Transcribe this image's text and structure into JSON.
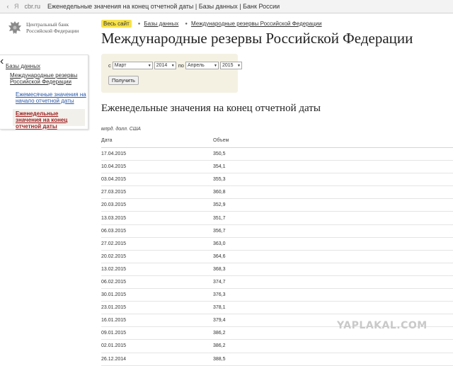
{
  "browser": {
    "back_icon": "arrow-left-icon",
    "brand": "Я",
    "domain": "cbr.ru",
    "page_title": "Еженедельные значения на конец отчетной даты | Базы данных | Банк России"
  },
  "logo": {
    "line1": "Центральный банк",
    "line2": "Российской Федерации"
  },
  "sidebar": {
    "header": "Базы данных",
    "items": [
      {
        "label": "Международные резервы Российской Федерации"
      },
      {
        "label": "Ежемесячные значения на начало отчетной даты"
      },
      {
        "label": "Еженедельные значения на конец отчетной даты"
      }
    ],
    "toggle_icon": "chevron-left-icon"
  },
  "breadcrumb": {
    "home": "Весь сайт",
    "items": [
      "Базы данных",
      "Международные резервы Российской Федерации"
    ]
  },
  "title": "Международные резервы Российской Федерации",
  "filter": {
    "from_label": "с",
    "to_label": "по",
    "from_month": "Март",
    "from_year": "2014",
    "to_month": "Апрель",
    "to_year": "2015",
    "submit": "Получить"
  },
  "section_title": "Еженедельные значения на конец отчетной даты",
  "units": "млрд. долл. США",
  "table": {
    "headers": [
      "Дата",
      "Объем"
    ],
    "rows": [
      [
        "17.04.2015",
        "350,5"
      ],
      [
        "10.04.2015",
        "354,1"
      ],
      [
        "03.04.2015",
        "355,3"
      ],
      [
        "27.03.2015",
        "360,8"
      ],
      [
        "20.03.2015",
        "352,9"
      ],
      [
        "13.03.2015",
        "351,7"
      ],
      [
        "06.03.2015",
        "356,7"
      ],
      [
        "27.02.2015",
        "363,0"
      ],
      [
        "20.02.2015",
        "364,6"
      ],
      [
        "13.02.2015",
        "368,3"
      ],
      [
        "06.02.2015",
        "374,7"
      ],
      [
        "30.01.2015",
        "376,3"
      ],
      [
        "23.01.2015",
        "378,1"
      ],
      [
        "16.01.2015",
        "379,4"
      ],
      [
        "09.01.2015",
        "386,2"
      ],
      [
        "02.01.2015",
        "386,2"
      ],
      [
        "26.12.2014",
        "388,5"
      ]
    ]
  },
  "watermark": "YAPLAKAL.COM"
}
